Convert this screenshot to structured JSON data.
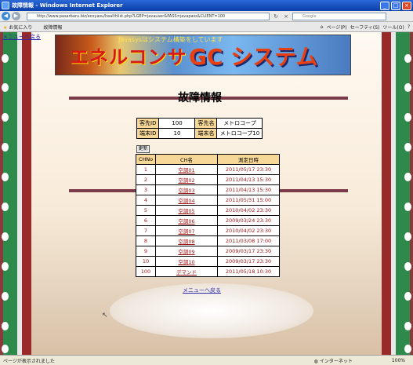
{
  "window": {
    "title": "故障情報 - Windows Internet Explorer",
    "minimize": "_",
    "maximize": "□",
    "close": "×"
  },
  "address": {
    "url": "http://www.pasarbaru.biz/ecoyasu/healthlist.php?LGEP=javauser&PASS=javapass&CLIENT=100",
    "back": "◀",
    "forward": "▶",
    "refresh": "↻",
    "stop": "×",
    "search_placeholder": "Google"
  },
  "favbar": {
    "favorites": "お気に入り",
    "tab_title": "故障情報",
    "page_menu": "ページ(P)",
    "safety_menu": "セーフティ(S)",
    "tools_menu": "ツール(O)",
    "help": "?"
  },
  "page": {
    "menu_link_top": "メニューへ戻る",
    "banner_tagline": "Javasysはシステム構築をしています",
    "banner_logo_left": "エネルコンサ",
    "banner_logo_right": "GC システム",
    "title": "故障情報",
    "info": {
      "client_id_label": "客先ID",
      "client_id": "100",
      "client_name_label": "客先名",
      "client_name": "メトロコープ",
      "terminal_id_label": "端末ID",
      "terminal_id": "10",
      "terminal_name_label": "端末名",
      "terminal_name": "メトロコープ10"
    },
    "update_button": "更新",
    "table": {
      "headers": [
        "CHNo",
        "CH名",
        "測定日時"
      ],
      "rows": [
        {
          "no": "1",
          "name": "空調01",
          "date": "2011/05/17 23:30"
        },
        {
          "no": "2",
          "name": "空調02",
          "date": "2011/04/13 15:30"
        },
        {
          "no": "3",
          "name": "空調03",
          "date": "2011/04/13 15:30"
        },
        {
          "no": "4",
          "name": "空調04",
          "date": "2011/05/31 15:00"
        },
        {
          "no": "5",
          "name": "空調05",
          "date": "2010/04/02 23:30"
        },
        {
          "no": "6",
          "name": "空調06",
          "date": "2009/03/24 23:30"
        },
        {
          "no": "7",
          "name": "空調07",
          "date": "2010/04/02 23:30"
        },
        {
          "no": "8",
          "name": "空調08",
          "date": "2011/03/08 17:00"
        },
        {
          "no": "9",
          "name": "空調09",
          "date": "2009/03/17 23:30"
        },
        {
          "no": "10",
          "name": "空調10",
          "date": "2009/03/17 23:30"
        },
        {
          "no": "100",
          "name": "デマンド",
          "date": "2011/05/18 10:30"
        }
      ]
    },
    "menu_link_bottom": "メニューへ戻る"
  },
  "status": {
    "message": "ページが表示されました",
    "zone": "インターネット",
    "zoom": "100%"
  }
}
